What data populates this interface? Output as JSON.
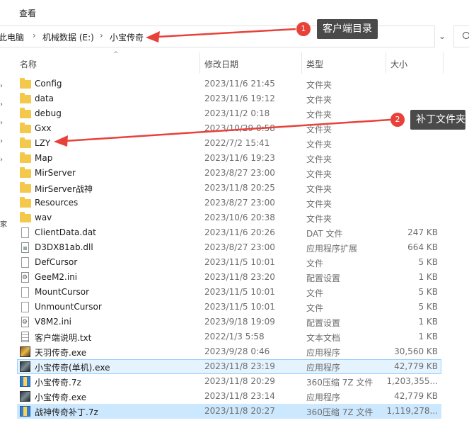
{
  "menubar": {
    "view_label": "查看"
  },
  "breadcrumb": {
    "this_pc": "此电脑",
    "drive": "机械数据 (E:)",
    "folder": "小宝传奇"
  },
  "nav_pane": {
    "label": "家"
  },
  "columns": {
    "name": "名称",
    "date": "修改日期",
    "type": "类型",
    "size": "大小"
  },
  "files": [
    {
      "name": "Config",
      "date": "2023/11/6 21:45",
      "type": "文件夹",
      "size": "",
      "icon": "folder-icon"
    },
    {
      "name": "data",
      "date": "2023/11/6 19:12",
      "type": "文件夹",
      "size": "",
      "icon": "folder-icon"
    },
    {
      "name": "debug",
      "date": "2023/11/2 0:18",
      "type": "文件夹",
      "size": "",
      "icon": "folder-icon"
    },
    {
      "name": "Gxx",
      "date": "2023/10/29 0:58",
      "type": "文件夹",
      "size": "",
      "icon": "folder-icon"
    },
    {
      "name": "LZY",
      "date": "2022/7/2 15:41",
      "type": "文件夹",
      "size": "",
      "icon": "folder-icon"
    },
    {
      "name": "Map",
      "date": "2023/11/6 19:23",
      "type": "文件夹",
      "size": "",
      "icon": "folder-icon"
    },
    {
      "name": "MirServer",
      "date": "2023/8/27 23:00",
      "type": "文件夹",
      "size": "",
      "icon": "folder-icon"
    },
    {
      "name": "MirServer战神",
      "date": "2023/11/8 20:25",
      "type": "文件夹",
      "size": "",
      "icon": "folder-icon"
    },
    {
      "name": "Resources",
      "date": "2023/8/27 23:00",
      "type": "文件夹",
      "size": "",
      "icon": "folder-icon"
    },
    {
      "name": "wav",
      "date": "2023/10/6 20:38",
      "type": "文件夹",
      "size": "",
      "icon": "folder-icon"
    },
    {
      "name": "ClientData.dat",
      "date": "2023/11/6 20:26",
      "type": "DAT 文件",
      "size": "247 KB",
      "icon": "dat-file-icon"
    },
    {
      "name": "D3DX81ab.dll",
      "date": "2023/8/27 23:00",
      "type": "应用程序扩展",
      "size": "664 KB",
      "icon": "dll-file-icon"
    },
    {
      "name": "DefCursor",
      "date": "2023/11/5 10:01",
      "type": "文件",
      "size": "5 KB",
      "icon": "blank-file-icon"
    },
    {
      "name": "GeeM2.ini",
      "date": "2023/11/8 23:20",
      "type": "配置设置",
      "size": "1 KB",
      "icon": "settings-file-icon"
    },
    {
      "name": "MountCursor",
      "date": "2023/11/5 10:01",
      "type": "文件",
      "size": "5 KB",
      "icon": "blank-file-icon"
    },
    {
      "name": "UnmountCursor",
      "date": "2023/11/5 10:01",
      "type": "文件",
      "size": "5 KB",
      "icon": "blank-file-icon"
    },
    {
      "name": "V8M2.ini",
      "date": "2023/9/18 19:09",
      "type": "配置设置",
      "size": "1 KB",
      "icon": "settings-file-icon"
    },
    {
      "name": "客户端说明.txt",
      "date": "2022/1/3 5:58",
      "type": "文本文档",
      "size": "1 KB",
      "icon": "text-file-icon"
    },
    {
      "name": "天羽传奇.exe",
      "date": "2023/9/28 0:46",
      "type": "应用程序",
      "size": "30,560 KB",
      "icon": "game-exe-icon"
    },
    {
      "name": "小宝传奇(单机).exe",
      "date": "2023/11/8 23:19",
      "type": "应用程序",
      "size": "42,779 KB",
      "icon": "game-exe-icon"
    },
    {
      "name": "小宝传奇.7z",
      "date": "2023/11/8 20:29",
      "type": "360压缩 7Z 文件",
      "size": "1,203,355...",
      "icon": "archive-icon"
    },
    {
      "name": "小宝传奇.exe",
      "date": "2023/11/8 23:14",
      "type": "应用程序",
      "size": "42,779 KB",
      "icon": "game-exe-icon"
    },
    {
      "name": "战神传奇补丁.7z",
      "date": "2023/11/8 20:27",
      "type": "360压缩 7Z 文件",
      "size": "1,119,278...",
      "icon": "archive-icon"
    }
  ],
  "annotations": [
    {
      "number": "1",
      "text": "客户端目录"
    },
    {
      "number": "2",
      "text": "补丁文件夹"
    }
  ],
  "colors": {
    "selection": "#cce8ff",
    "folder": "#f4c84b",
    "callout_bg": "#4a4a4a",
    "badge": "#e8413a",
    "arrow": "#e8413a"
  }
}
